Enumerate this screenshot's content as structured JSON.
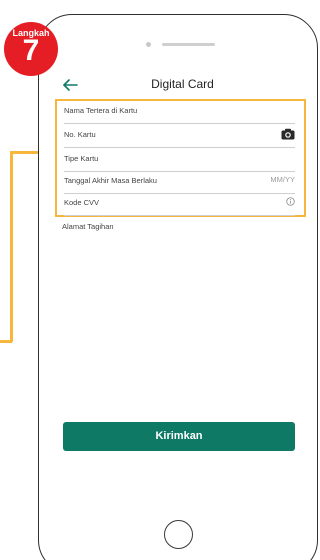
{
  "step": {
    "label": "Langkah",
    "number": "7",
    "color": "#e51e25"
  },
  "header": {
    "title": "Digital Card",
    "back_icon": "arrow-left-icon"
  },
  "form": {
    "highlight_color": "#f7b73c",
    "fields": [
      {
        "label": "Nama Tertera di Kartu",
        "right": ""
      },
      {
        "label": "No. Kartu",
        "right_icon": "camera-icon"
      },
      {
        "label": "Tipe Kartu",
        "right": ""
      },
      {
        "label": "Tanggal Akhir Masa Berlaku",
        "right": "MM/YY"
      },
      {
        "label": "Kode CVV",
        "right_icon": "info-icon"
      }
    ],
    "billing_label": "Alamat Tagihan"
  },
  "submit": {
    "label": "Kirimkan",
    "color": "#0e7a66"
  }
}
